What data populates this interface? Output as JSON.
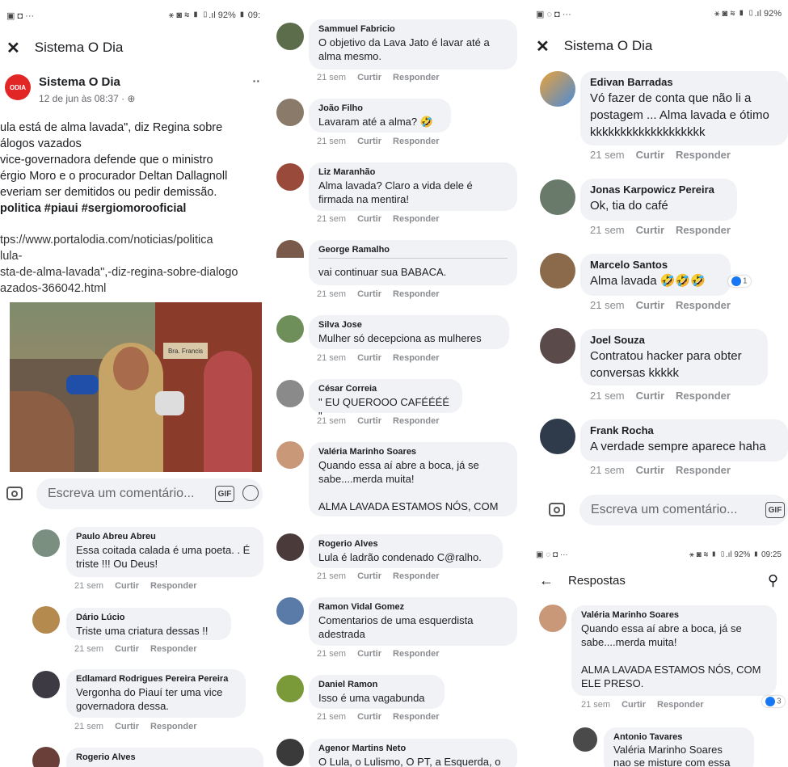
{
  "left": {
    "status": {
      "left": "▣ ◘ ···",
      "right": "⚹ ◙ ≋ ▮ ▯.ıl 92% ▮ 09:"
    },
    "title": "Sistema O Dia",
    "post": {
      "author": "Sistema O Dia",
      "date": "12 de jun às 08:37 · ⊕",
      "logo_text": "ODIA",
      "lines": [
        "ula está de alma lavada\", diz Regina sobre",
        "álogos vazados",
        "vice-governadora defende que o ministro",
        "érgio Moro e o procurador Deltan Dallagnoll",
        "everiam ser demitidos ou pedir demissão.",
        "politica #piaui #sergiomorooficial"
      ],
      "link_lines": [
        "tps://www.portalodia.com/noticias/politica",
        "lula-",
        "sta-de-alma-lavada\",-diz-regina-sobre-dialogo",
        "azados-366042.html"
      ],
      "photo_sign": "Bra. Francis"
    },
    "compose_placeholder": "Escreva um comentário...",
    "gif": "GIF",
    "comments": [
      {
        "name": "Paulo Abreu Abreu",
        "text": "Essa coitada calada é uma poeta. . É\ntriste !!! Ou Deus!"
      },
      {
        "name": "Dário Lúcio",
        "text": "Triste uma criatura dessas !!"
      },
      {
        "name": "Edlamard Rodrigues Pereira Pereira",
        "text": "Vergonha do Piauí ter uma vice\ngovernadora dessa."
      },
      {
        "name": "Rogerio Alves",
        "text": ""
      }
    ]
  },
  "meta": {
    "time": "21 sem",
    "like": "Curtir",
    "reply": "Responder"
  },
  "middle": {
    "comments": [
      {
        "name": "Sammuel Fabricio",
        "text": "O objetivo da Lava Jato é lavar até a\nalma mesmo."
      },
      {
        "name": "João Filho",
        "text": "Lavaram até a alma? 🤣"
      },
      {
        "name": "Liz Maranhão",
        "text": "Alma lavada? Claro a vida dele é\nfirmada na mentira!"
      },
      {
        "name": "George Ramalho",
        "text": "vai continuar sua BABACA."
      },
      {
        "name": "Silva Jose",
        "text": "Mulher só decepciona as mulheres"
      },
      {
        "name": "César Correia",
        "text": "\" EU QUEROOO CAFÉÉÉÉ \""
      },
      {
        "name": "Valéria Marinho Soares",
        "text": "Quando essa aí abre a boca, já se\nsabe....merda muita!\n\nALMA LAVADA ESTAMOS NÓS, COM"
      },
      {
        "name": "Rogerio Alves",
        "text": "Lula é ladrão condenado C@ralho."
      },
      {
        "name": "Ramon Vidal Gomez",
        "text": "Comentarios de uma esquerdista\nadestrada"
      },
      {
        "name": "Daniel Ramon",
        "text": "Isso é uma vagabunda"
      },
      {
        "name": "Agenor Martins Neto",
        "text": "O Lula, o Lulismo, O PT, a Esquerda, o"
      }
    ]
  },
  "right_top": {
    "status": {
      "left": "▣ ◌ ◘ ···",
      "right": "⚹ ◙ ≋ ▮ ▯.ıl 92%"
    },
    "title": "Sistema O Dia",
    "comments": [
      {
        "name": "Edivan Barradas",
        "text": "Vó fazer de conta que não li a\npostagem ... Alma lavada e ótimo\nkkkkkkkkkkkkkkkkkkk"
      },
      {
        "name": "Jonas Karpowicz Pereira",
        "text": "Ok, tia do café"
      },
      {
        "name": "Marcelo Santos",
        "text": "Alma lavada 🤣🤣🤣",
        "reactions": "1"
      },
      {
        "name": "Joel Souza",
        "text": "Contratou hacker para obter\nconversas kkkkk"
      },
      {
        "name": "Frank Rocha",
        "text": "A verdade sempre aparece haha"
      }
    ],
    "compose_placeholder": "Escreva um comentário...",
    "gif": "GIF"
  },
  "right_bottom": {
    "status": {
      "left": "▣ ◌ ◘ ···",
      "right": "⚹ ◙ ≋ ▮ ▯.ıl 92% ▮ 09:25"
    },
    "title": "Respostas",
    "main": {
      "name": "Valéria Marinho Soares",
      "text": "Quando essa aí abre a boca, já se\nsabe....merda muita!\n\nALMA LAVADA ESTAMOS NÓS, COM\nELE PRESO.",
      "reactions": "3"
    },
    "reply": {
      "name": "Antonio Tavares",
      "text": "Valéria Marinho Soares\nnao se misture com essa"
    }
  }
}
